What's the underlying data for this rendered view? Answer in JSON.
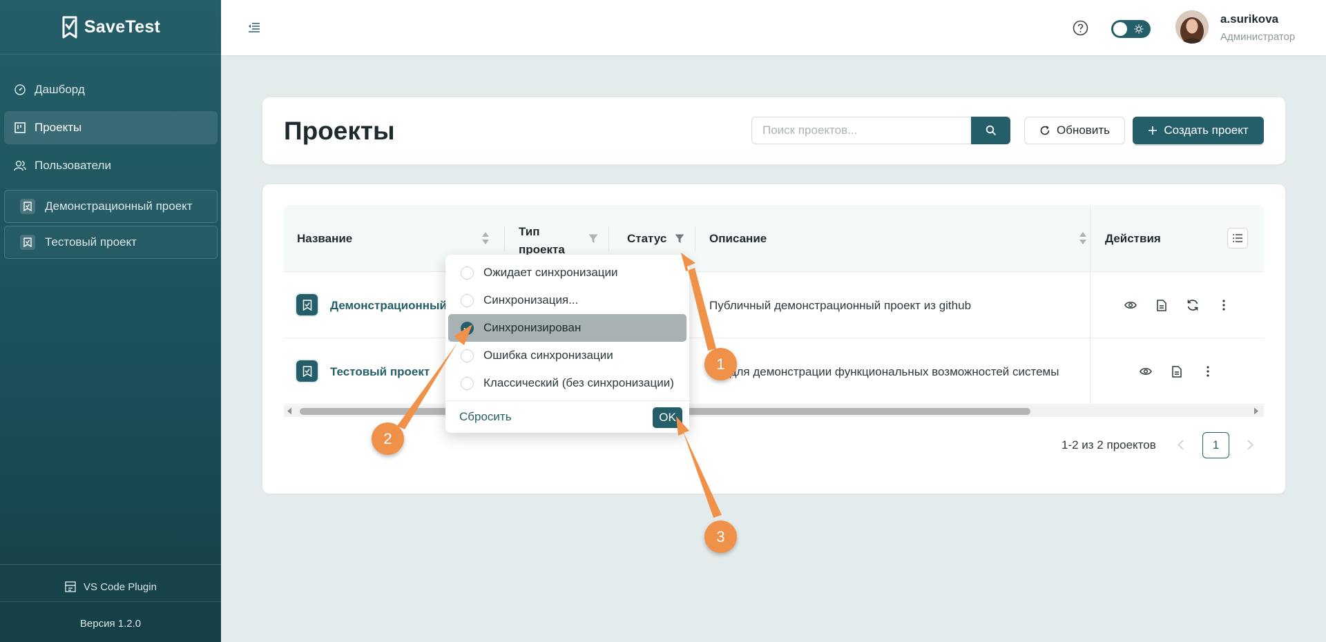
{
  "app": {
    "name": "SaveTest"
  },
  "sidebar": {
    "nav": [
      {
        "label": "Дашборд",
        "icon": "dashboard-icon"
      },
      {
        "label": "Проекты",
        "icon": "projects-icon"
      },
      {
        "label": "Пользователи",
        "icon": "users-icon"
      }
    ],
    "projects": [
      {
        "label": "Демонстрационный проект"
      },
      {
        "label": "Тестовый проект"
      }
    ],
    "plugin": "VS Code Plugin",
    "version": "Версия 1.2.0"
  },
  "header": {
    "user": {
      "name": "a.surikova",
      "role": "Администратор"
    }
  },
  "page": {
    "title": "Проекты",
    "search_placeholder": "Поиск проектов...",
    "refresh_label": "Обновить",
    "create_label": "Создать проект"
  },
  "table": {
    "columns": {
      "name": "Название",
      "type_line1": "Тип",
      "type_line2": "проекта",
      "status": "Статус",
      "description": "Описание",
      "actions": "Действия"
    },
    "rows": [
      {
        "name": "Демонстрационный",
        "description": "Публичный демонстрационный проект из github"
      },
      {
        "name": "Тестовый проект",
        "description": "ект для демонстрации функциональных возможностей системы"
      }
    ],
    "pagination": {
      "summary": "1-2 из 2 проектов",
      "current_page": "1"
    }
  },
  "status_filter": {
    "options": [
      {
        "label": "Ожидает синхронизации",
        "checked": false
      },
      {
        "label": "Синхронизация...",
        "checked": false
      },
      {
        "label": "Синхронизирован",
        "checked": true
      },
      {
        "label": "Ошибка синхронизации",
        "checked": false
      },
      {
        "label": "Классический (без синхронизации)",
        "checked": false
      }
    ],
    "reset_label": "Сбросить",
    "ok_label": "OK"
  },
  "annotations": [
    "1",
    "2",
    "3"
  ],
  "colors": {
    "primary": "#245e69",
    "annotation": "#f0914a",
    "background": "#e3ebec"
  }
}
